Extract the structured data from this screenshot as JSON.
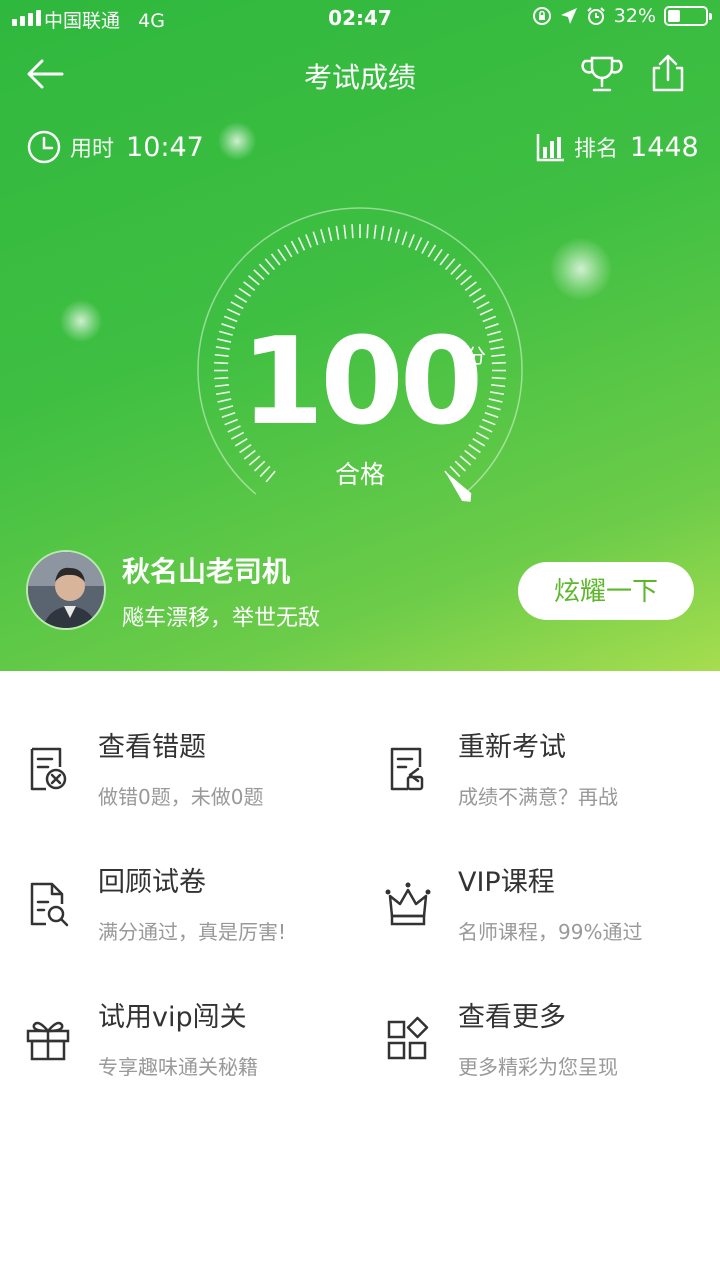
{
  "status_bar": {
    "carrier": "中国联通",
    "network": "4G",
    "time": "02:47",
    "battery": "32%",
    "battery_level": 0.32
  },
  "nav": {
    "title": "考试成绩",
    "back_icon": "arrow-left-icon",
    "trophy_icon": "trophy-icon",
    "share_icon": "share-icon"
  },
  "stats": {
    "time_label": "用时",
    "time_value": "10:47",
    "rank_label": "排名",
    "rank_value": "1448"
  },
  "score": {
    "value": "100",
    "unit": "分",
    "result": "合格"
  },
  "user": {
    "name": "秋名山老司机",
    "motto": "飚车漂移，举世无敌",
    "brag_button": "炫耀一下"
  },
  "menu": [
    {
      "title": "查看错题",
      "subtitle": "做错0题，未做0题",
      "icon": "wrong-answers-icon"
    },
    {
      "title": "重新考试",
      "subtitle": "成绩不满意？再战",
      "icon": "retake-exam-icon"
    },
    {
      "title": "回顾试卷",
      "subtitle": "满分通过，真是厉害!",
      "icon": "review-paper-icon"
    },
    {
      "title": "VIP课程",
      "subtitle": "名师课程，99%通过",
      "icon": "crown-icon"
    },
    {
      "title": "试用vip闯关",
      "subtitle": "专享趣味通关秘籍",
      "icon": "gift-icon"
    },
    {
      "title": "查看更多",
      "subtitle": "更多精彩为您呈现",
      "icon": "more-grid-icon"
    }
  ],
  "colors": {
    "hero_start": "#2fb83e",
    "hero_end": "#a6dd4f",
    "button_text": "#5cb82a"
  }
}
